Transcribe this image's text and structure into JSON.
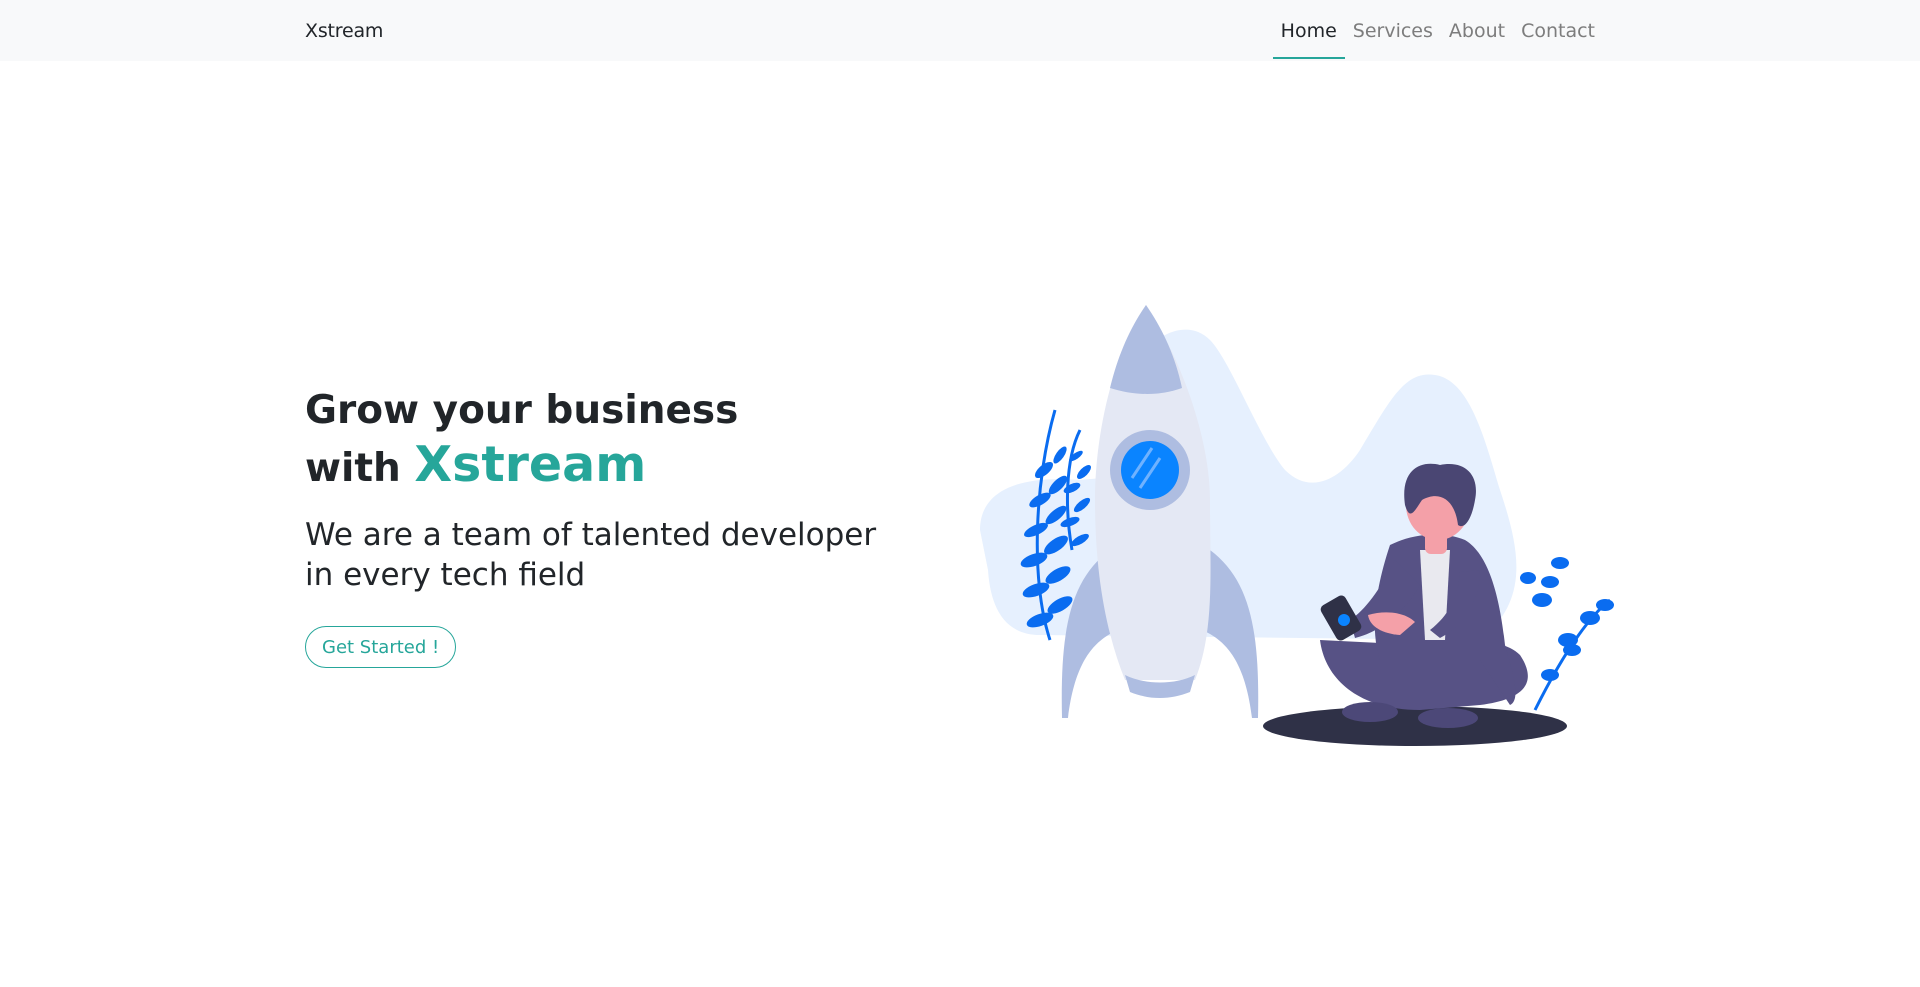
{
  "navbar": {
    "brand": "Xstream",
    "links": [
      {
        "label": "Home",
        "active": true
      },
      {
        "label": "Services",
        "active": false
      },
      {
        "label": "About",
        "active": false
      },
      {
        "label": "Contact",
        "active": false
      }
    ]
  },
  "hero": {
    "title_line1": "Grow your business",
    "title_prefix": "with",
    "title_brand": "Xstream",
    "subtitle": "We are a team of talented developer in every tech field",
    "cta_label": "Get Started !"
  },
  "colors": {
    "accent": "#26a69a",
    "navbar_bg": "#f8f9fa",
    "rocket": "#aebde1",
    "rocket_body": "#e4e8f4",
    "window": "#0a84ff",
    "person_suit": "#575285",
    "skin": "#f4a0a8",
    "plants": "#0a6cf0",
    "shadow": "#2f3147"
  },
  "illustration": {
    "icon": "rocket-launch-illustration"
  }
}
